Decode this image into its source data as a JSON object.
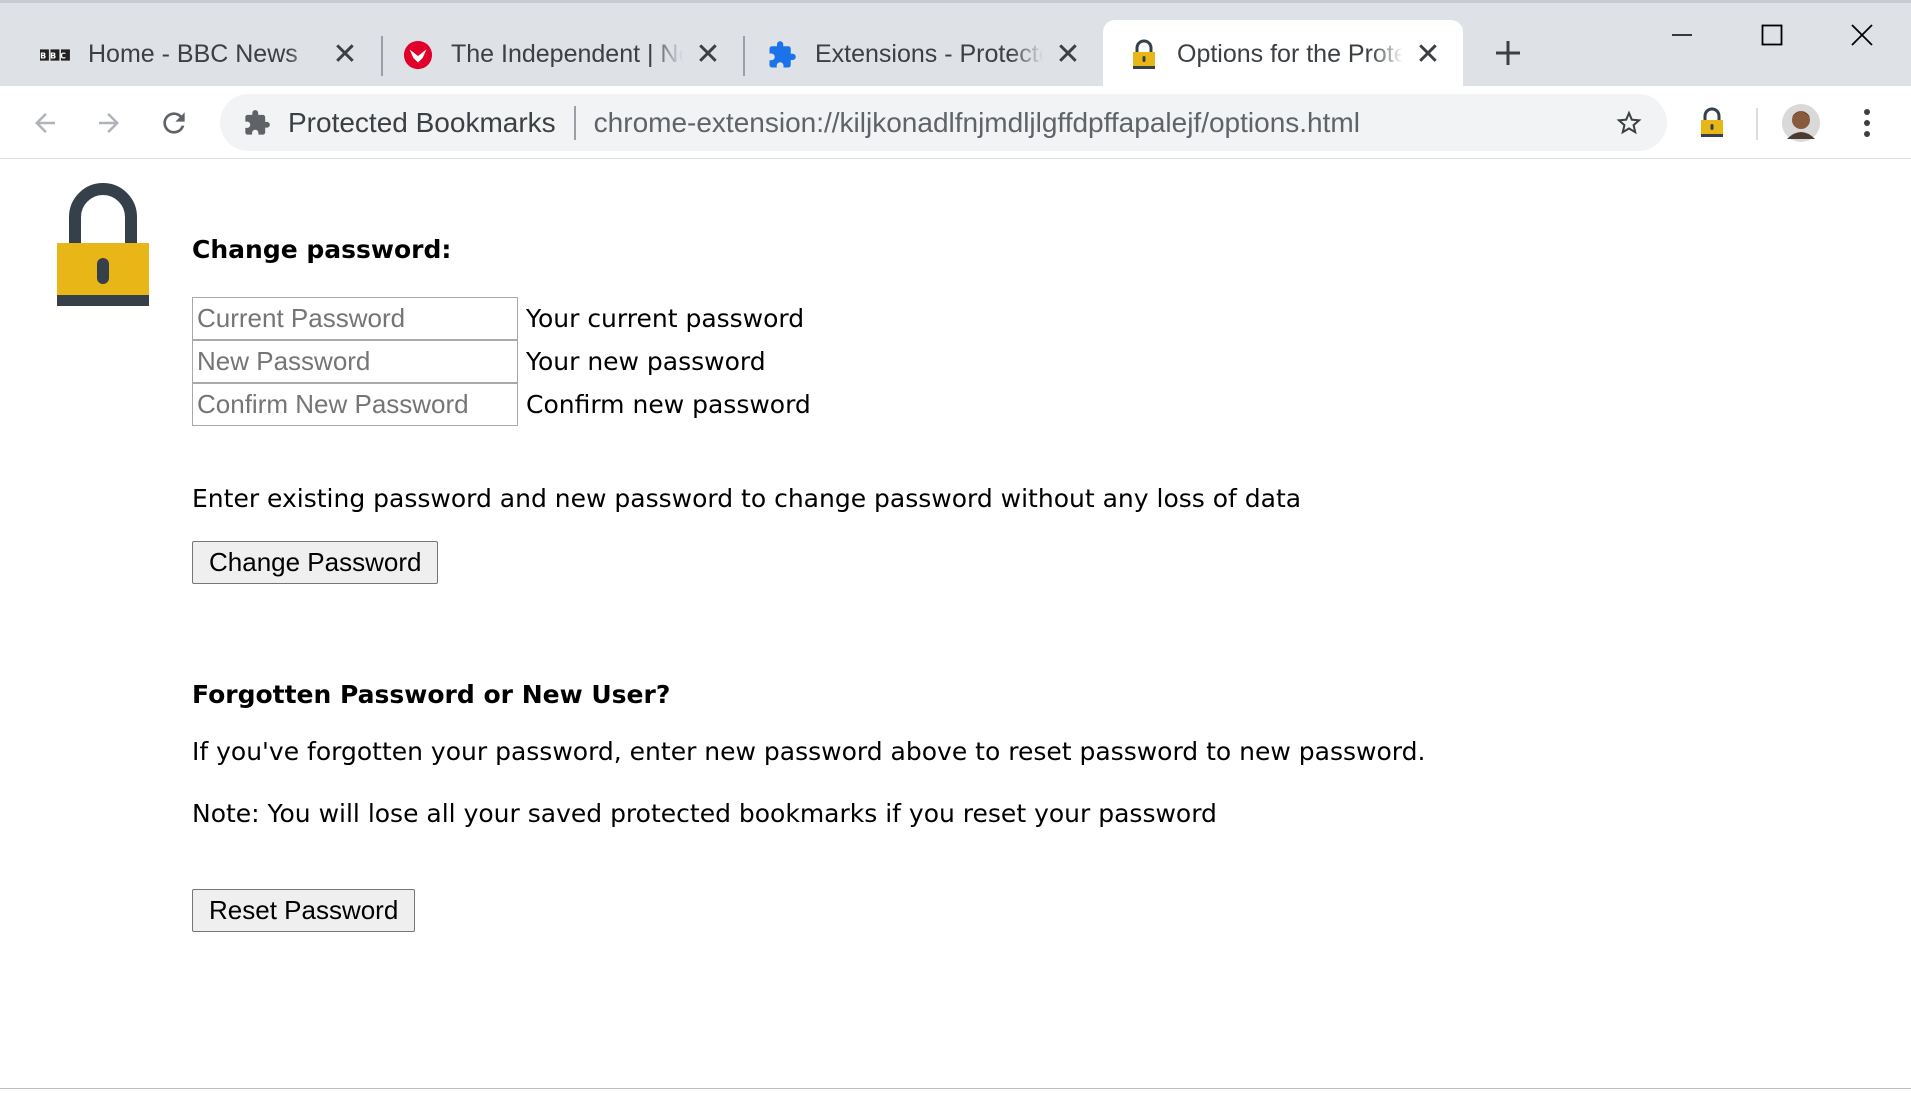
{
  "tabs": [
    {
      "title": "Home - BBC News",
      "favicon": "bbc-logo-icon",
      "active": false
    },
    {
      "title": "The Independent | News",
      "favicon": "independent-eagle-icon",
      "active": false
    },
    {
      "title": "Extensions - Protected Bookmarks",
      "favicon": "puzzle-piece-icon",
      "active": false
    },
    {
      "title": "Options for the Protected Bookmarks",
      "favicon": "padlock-icon",
      "active": true
    }
  ],
  "bbc_logo_text": "BBC",
  "toolbar": {
    "extension_name": "Protected Bookmarks",
    "url": "chrome-extension://kiljkonadlfnjmdljlgffdpffapalejf/options.html"
  },
  "colors": {
    "tabstrip_bg": "#dee1e6",
    "omnibox_bg": "#f1f3f4",
    "lock_yellow": "#e8b617",
    "lock_dark": "#36404a",
    "extension_blue": "#1a73e8",
    "independent_red": "#e0002a"
  },
  "page": {
    "change_heading": "Change password:",
    "fields": [
      {
        "placeholder": "Current Password",
        "hint": "Your current password"
      },
      {
        "placeholder": "New Password",
        "hint": "Your new password"
      },
      {
        "placeholder": "Confirm New Password",
        "hint": "Confirm new password"
      }
    ],
    "change_info": "Enter existing password and new password to change password without any loss of data",
    "change_button": "Change Password",
    "forgot_heading": "Forgotten Password or New User?",
    "forgot_info": "If you've forgotten your password, enter new password above to reset password to new password.",
    "note": "Note: You will lose all your saved protected bookmarks if you reset your password",
    "reset_button": "Reset Password"
  }
}
